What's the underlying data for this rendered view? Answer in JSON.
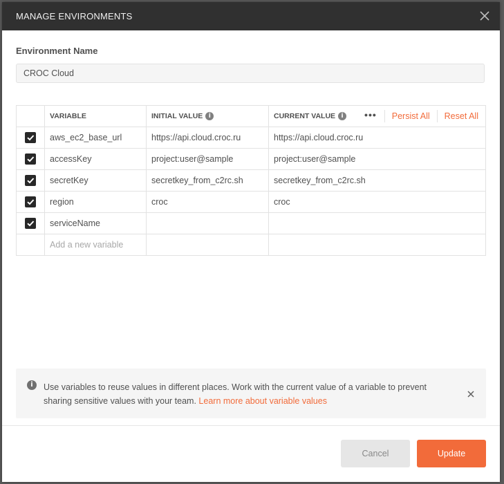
{
  "modal": {
    "title": "MANAGE ENVIRONMENTS"
  },
  "environment": {
    "label": "Environment Name",
    "value": "CROC Cloud"
  },
  "table": {
    "headers": {
      "variable": "VARIABLE",
      "initial": "INITIAL VALUE",
      "current": "CURRENT VALUE"
    },
    "actions": {
      "more": "•••",
      "persist": "Persist All",
      "reset": "Reset All"
    },
    "rows": [
      {
        "checked": true,
        "variable": "aws_ec2_base_url",
        "initial": "https://api.cloud.croc.ru",
        "current": "https://api.cloud.croc.ru"
      },
      {
        "checked": true,
        "variable": "accessKey",
        "initial": "project:user@sample",
        "current": "project:user@sample"
      },
      {
        "checked": true,
        "variable": "secretKey",
        "initial": "secretkey_from_c2rc.sh",
        "current": "secretkey_from_c2rc.sh"
      },
      {
        "checked": true,
        "variable": "region",
        "initial": "croc",
        "current": "croc"
      },
      {
        "checked": true,
        "variable": "serviceName",
        "initial": "",
        "current": ""
      }
    ],
    "new_row_placeholder": "Add a new variable"
  },
  "info": {
    "text": "Use variables to reuse values in different places. Work with the current value of a variable to prevent sharing sensitive values with your team.",
    "link": "Learn more about variable values"
  },
  "footer": {
    "cancel": "Cancel",
    "update": "Update"
  },
  "colors": {
    "accent": "#f26b3a",
    "header_bg": "#303030"
  }
}
